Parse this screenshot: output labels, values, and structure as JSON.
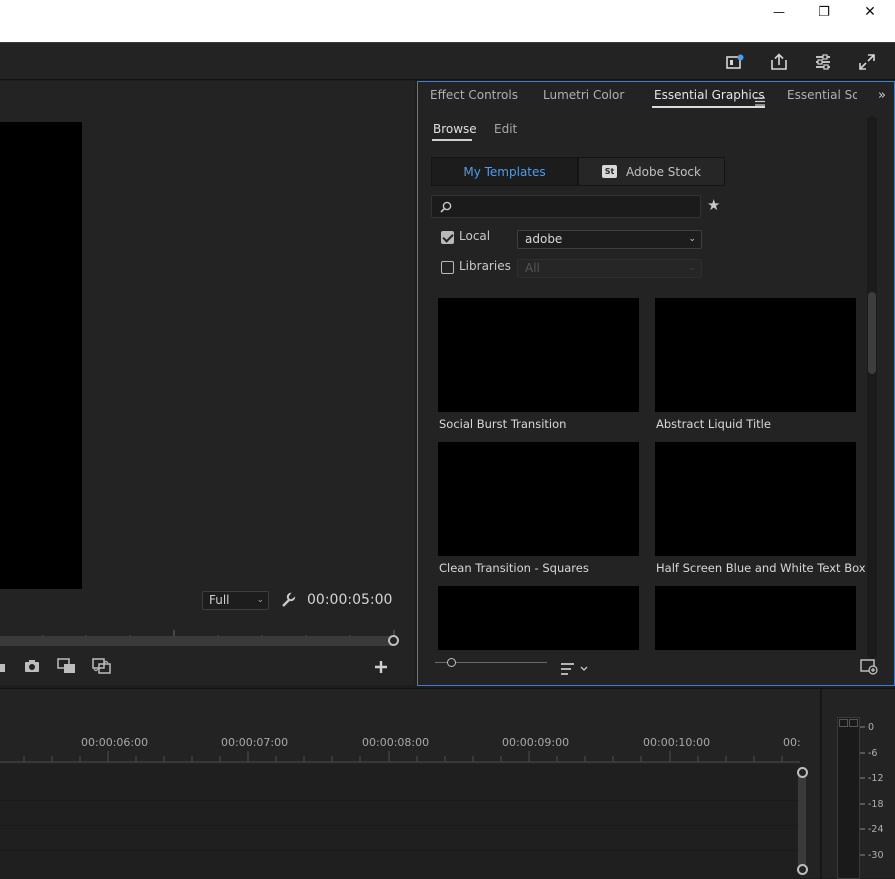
{
  "window_controls": {
    "minimize": "—",
    "restore": "❐",
    "close": "✕"
  },
  "header_icons": [
    "quick-export-badge-icon",
    "share-icon",
    "workspaces-menu-icon",
    "fullscreen-icon"
  ],
  "monitor": {
    "resolution": "Full",
    "timecode": "00:00:05:00"
  },
  "essential_graphics": {
    "tabs": [
      {
        "label": "Effect Controls",
        "active": false
      },
      {
        "label": "Lumetri Color",
        "active": false
      },
      {
        "label": "Essential Graphics",
        "active": true
      },
      {
        "label": "Essential Sou",
        "active": false
      }
    ],
    "subtabs": {
      "browse": "Browse",
      "edit": "Edit"
    },
    "segments": {
      "my_templates": "My Templates",
      "adobe_stock": "Adobe Stock",
      "stock_badge": "St"
    },
    "search": {
      "placeholder": ""
    },
    "filters": {
      "local_label": "Local",
      "local_checked": true,
      "local_source": "adobe",
      "libraries_label": "Libraries",
      "libraries_checked": false,
      "libraries_source": "All"
    },
    "templates": [
      {
        "label": "Social Burst Transition"
      },
      {
        "label": "Abstract Liquid Title"
      },
      {
        "label": "Clean Transition - Squares"
      },
      {
        "label": "Half Screen Blue and White Text Box"
      },
      {
        "label": ""
      },
      {
        "label": ""
      }
    ]
  },
  "timeline": {
    "timecodes": [
      "00:00:06:00",
      "00:00:07:00",
      "00:00:08:00",
      "00:00:09:00",
      "00:00:10:00",
      "00:"
    ],
    "meter_scale": [
      "0",
      "-6",
      "-12",
      "-18",
      "-24",
      "-30"
    ]
  },
  "colors": {
    "accent_blue": "#4f9dea",
    "panel_focus_border": "#3c7fd8",
    "panel_bg": "#232323"
  }
}
